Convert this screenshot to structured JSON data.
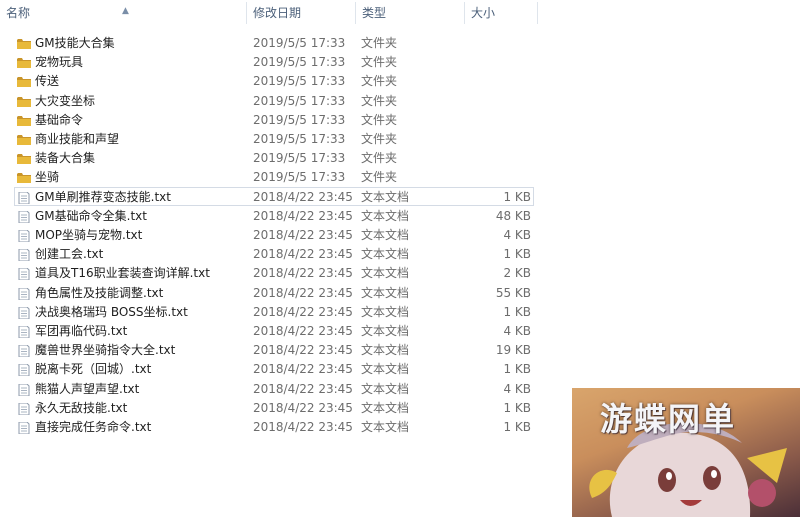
{
  "columns": {
    "name": "名称",
    "date": "修改日期",
    "type": "类型",
    "size": "大小"
  },
  "files": [
    {
      "name": "GM技能大合集",
      "date": "2019/5/5 17:33",
      "type": "文件夹",
      "size": "",
      "icon": "folder-icon"
    },
    {
      "name": "宠物玩具",
      "date": "2019/5/5 17:33",
      "type": "文件夹",
      "size": "",
      "icon": "folder-icon"
    },
    {
      "name": "传送",
      "date": "2019/5/5 17:33",
      "type": "文件夹",
      "size": "",
      "icon": "folder-icon"
    },
    {
      "name": "大灾变坐标",
      "date": "2019/5/5 17:33",
      "type": "文件夹",
      "size": "",
      "icon": "folder-icon"
    },
    {
      "name": "基础命令",
      "date": "2019/5/5 17:33",
      "type": "文件夹",
      "size": "",
      "icon": "folder-icon"
    },
    {
      "name": "商业技能和声望",
      "date": "2019/5/5 17:33",
      "type": "文件夹",
      "size": "",
      "icon": "folder-icon"
    },
    {
      "name": "装备大合集",
      "date": "2019/5/5 17:33",
      "type": "文件夹",
      "size": "",
      "icon": "folder-icon"
    },
    {
      "name": "坐骑",
      "date": "2019/5/5 17:33",
      "type": "文件夹",
      "size": "",
      "icon": "folder-icon"
    },
    {
      "name": "GM单刷推荐变态技能.txt",
      "date": "2018/4/22 23:45",
      "type": "文本文档",
      "size": "1 KB",
      "icon": "text-file-icon",
      "selected": true
    },
    {
      "name": "GM基础命令全集.txt",
      "date": "2018/4/22 23:45",
      "type": "文本文档",
      "size": "48 KB",
      "icon": "text-file-icon"
    },
    {
      "name": "MOP坐骑与宠物.txt",
      "date": "2018/4/22 23:45",
      "type": "文本文档",
      "size": "4 KB",
      "icon": "text-file-icon"
    },
    {
      "name": "创建工会.txt",
      "date": "2018/4/22 23:45",
      "type": "文本文档",
      "size": "1 KB",
      "icon": "text-file-icon"
    },
    {
      "name": "道具及T16职业套装查询详解.txt",
      "date": "2018/4/22 23:45",
      "type": "文本文档",
      "size": "2 KB",
      "icon": "text-file-icon"
    },
    {
      "name": "角色属性及技能调整.txt",
      "date": "2018/4/22 23:45",
      "type": "文本文档",
      "size": "55 KB",
      "icon": "text-file-icon"
    },
    {
      "name": "决战奥格瑞玛 BOSS坐标.txt",
      "date": "2018/4/22 23:45",
      "type": "文本文档",
      "size": "1 KB",
      "icon": "text-file-icon"
    },
    {
      "name": "军团再临代码.txt",
      "date": "2018/4/22 23:45",
      "type": "文本文档",
      "size": "4 KB",
      "icon": "text-file-icon"
    },
    {
      "name": "魔兽世界坐骑指令大全.txt",
      "date": "2018/4/22 23:45",
      "type": "文本文档",
      "size": "19 KB",
      "icon": "text-file-icon"
    },
    {
      "name": "脱离卡死（回城）.txt",
      "date": "2018/4/22 23:45",
      "type": "文本文档",
      "size": "1 KB",
      "icon": "text-file-icon"
    },
    {
      "name": "熊猫人声望声望.txt",
      "date": "2018/4/22 23:45",
      "type": "文本文档",
      "size": "4 KB",
      "icon": "text-file-icon"
    },
    {
      "name": "永久无敌技能.txt",
      "date": "2018/4/22 23:45",
      "type": "文本文档",
      "size": "1 KB",
      "icon": "text-file-icon"
    },
    {
      "name": "直接完成任务命令.txt",
      "date": "2018/4/22 23:45",
      "type": "文本文档",
      "size": "1 KB",
      "icon": "text-file-icon"
    }
  ],
  "watermark": {
    "text": "游蝶网单"
  },
  "colors": {
    "folder": "#e8b93a",
    "folder_dark": "#c9952a",
    "header_text": "#4c607a",
    "selection_border": "#d4dbe5"
  }
}
